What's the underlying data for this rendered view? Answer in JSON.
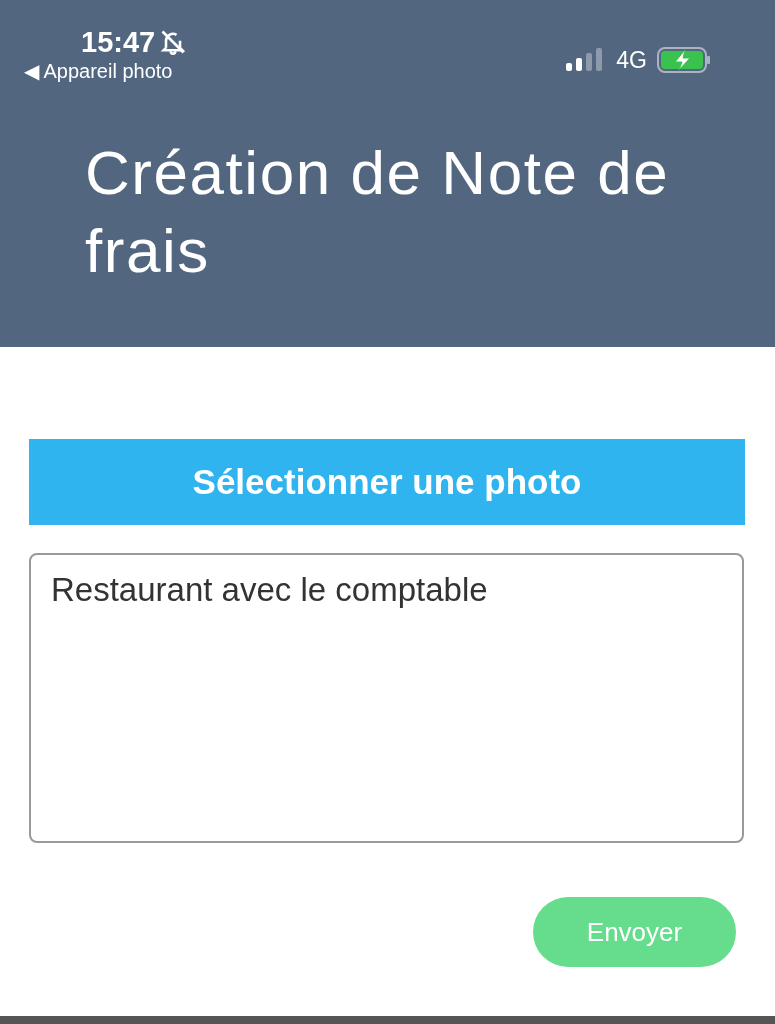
{
  "status_bar": {
    "time": "15:47",
    "back_label": "◀ Appareil photo",
    "network": "4G"
  },
  "header": {
    "title": "Création de Note de frais"
  },
  "select_photo_button": {
    "label": "Sélectionner une photo"
  },
  "description": {
    "value": "Restaurant avec le comptable"
  },
  "send_button": {
    "label": "Envoyer"
  }
}
